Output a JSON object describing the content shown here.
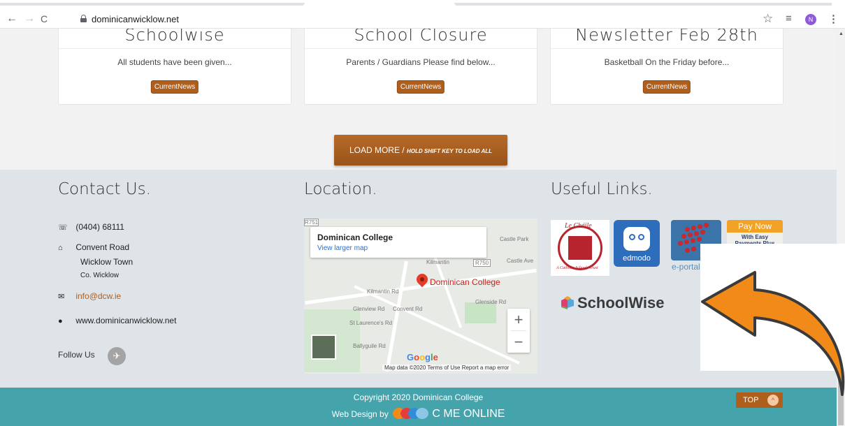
{
  "browser": {
    "back": "←",
    "forward": "→",
    "reload": "C",
    "url": "dominicanwicklow.net",
    "profile_initial": "N"
  },
  "news": {
    "cards": [
      {
        "title": "Schoolwise",
        "excerpt": "All students have been given...",
        "tag": "CurrentNews"
      },
      {
        "title": "School Closure",
        "excerpt": "Parents / Guardians Please find below...",
        "tag": "CurrentNews"
      },
      {
        "title": "Newsletter Feb 28th",
        "excerpt": "Basketball  On the Friday before...",
        "tag": "CurrentNews"
      }
    ],
    "load_more": "LOAD MORE /",
    "load_more_hint": "HOLD SHIFT KEY TO LOAD ALL"
  },
  "contact": {
    "heading": "Contact Us.",
    "phone": "(0404) 68111",
    "address_line1": "Convent Road",
    "address_line2": "Wicklow Town",
    "address_line3": "Co. Wicklow",
    "email": "info@dcw.ie",
    "website": "www.dominicanwicklow.net",
    "follow_label": "Follow Us"
  },
  "location": {
    "heading": "Location.",
    "info_title": "Dominican College",
    "info_link": "View larger map",
    "pin_label": "Dominican College",
    "road_labels": [
      "R751",
      "R750",
      "Kilmantin",
      "Kilmantin Rd",
      "Glenview Rd",
      "St Laurence's Rd",
      "Ballyguile Rd",
      "Convent Rd",
      "Glenside Rd",
      "Castle Park",
      "Castle Ave"
    ],
    "attribution": "Map data ©2020   Terms of Use   Report a map error",
    "google": [
      "G",
      "o",
      "o",
      "g",
      "l",
      "e"
    ]
  },
  "links": {
    "heading": "Useful Links.",
    "lecheile": "Le Chéile",
    "lecheile_sub": "A Catholic Schools Trust",
    "edmodo": "edmodo",
    "eportal": "e-portal login",
    "paynow_top": "Pay Now",
    "paynow_l1": "With Easy",
    "paynow_l2": "Payments Plus",
    "schoolwise": "SchoolWise"
  },
  "footer": {
    "copyright": "Copyright 2020 Dominican College",
    "webdesign": "Web Design by",
    "cme": "C ME ONLINE",
    "top": "TOP"
  },
  "colors": {
    "accent": "#b05e1c",
    "footer_bar": "#45a3ac",
    "arrow": "#f28a1a"
  }
}
